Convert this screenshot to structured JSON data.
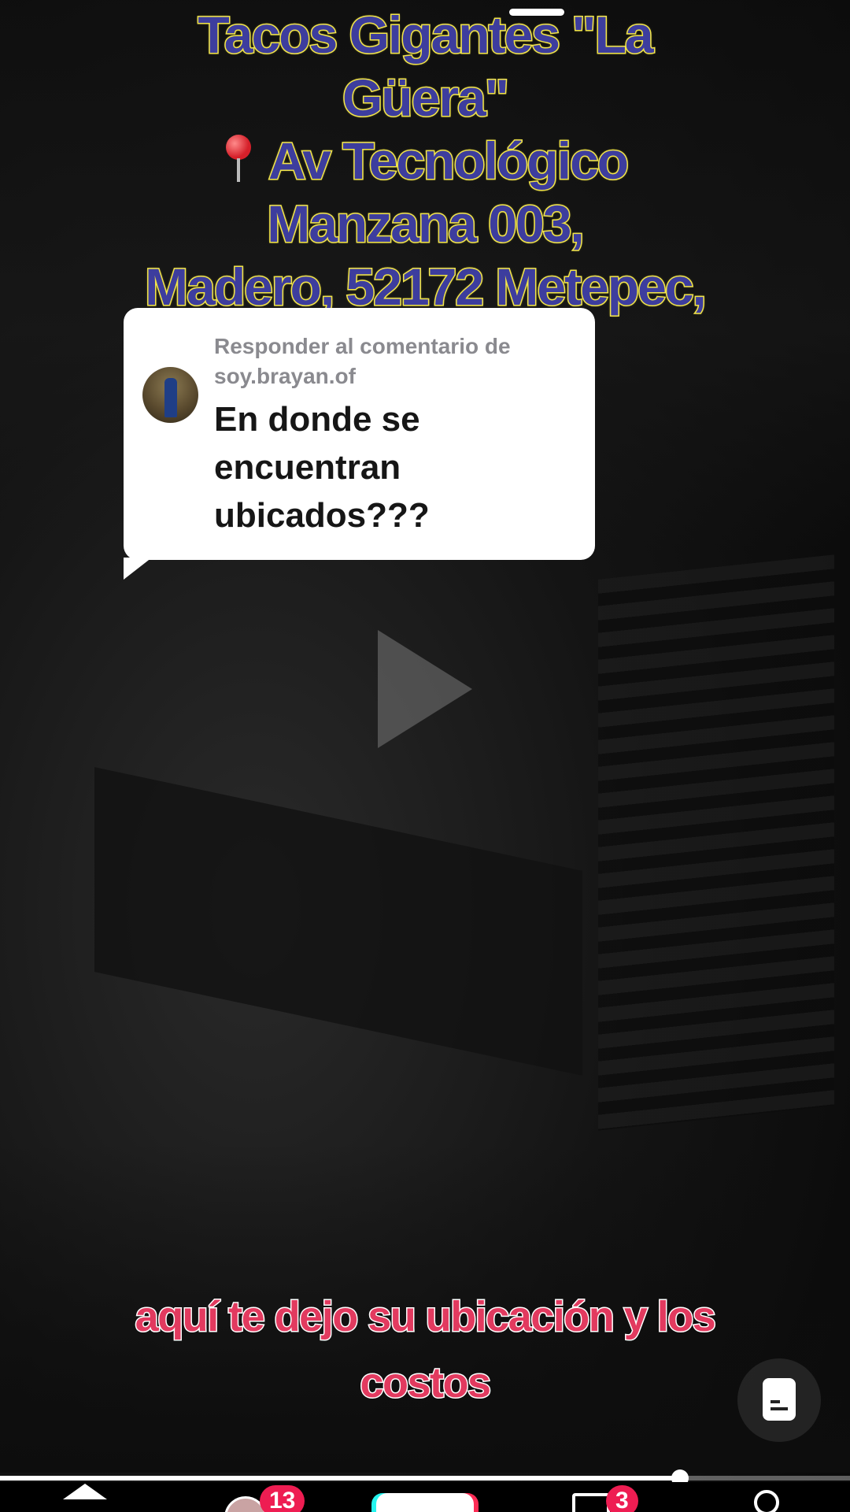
{
  "overlay": {
    "line1": "Tacos Gigantes \"La",
    "line2": "Güera\"",
    "line3": "Av Tecnológico",
    "line4": "Manzana 003,",
    "line5": "Madero, 52172 Metepec,",
    "pin_icon": "round-pushpin-icon",
    "text_color": "#3d3d9e",
    "outline_color": "#f2e54a"
  },
  "reply": {
    "label": "Responder al comentario de soy.brayan.of",
    "comment": "En donde se encuentran ubicados???"
  },
  "caption": {
    "text": "aquí te dejo su ubicación y los costos",
    "color": "#e23a5f"
  },
  "player": {
    "state": "paused",
    "progress": 0.8
  },
  "nav": {
    "friends_badge": "13",
    "inbox_badge": "3",
    "badge_color": "#ee1d52"
  }
}
